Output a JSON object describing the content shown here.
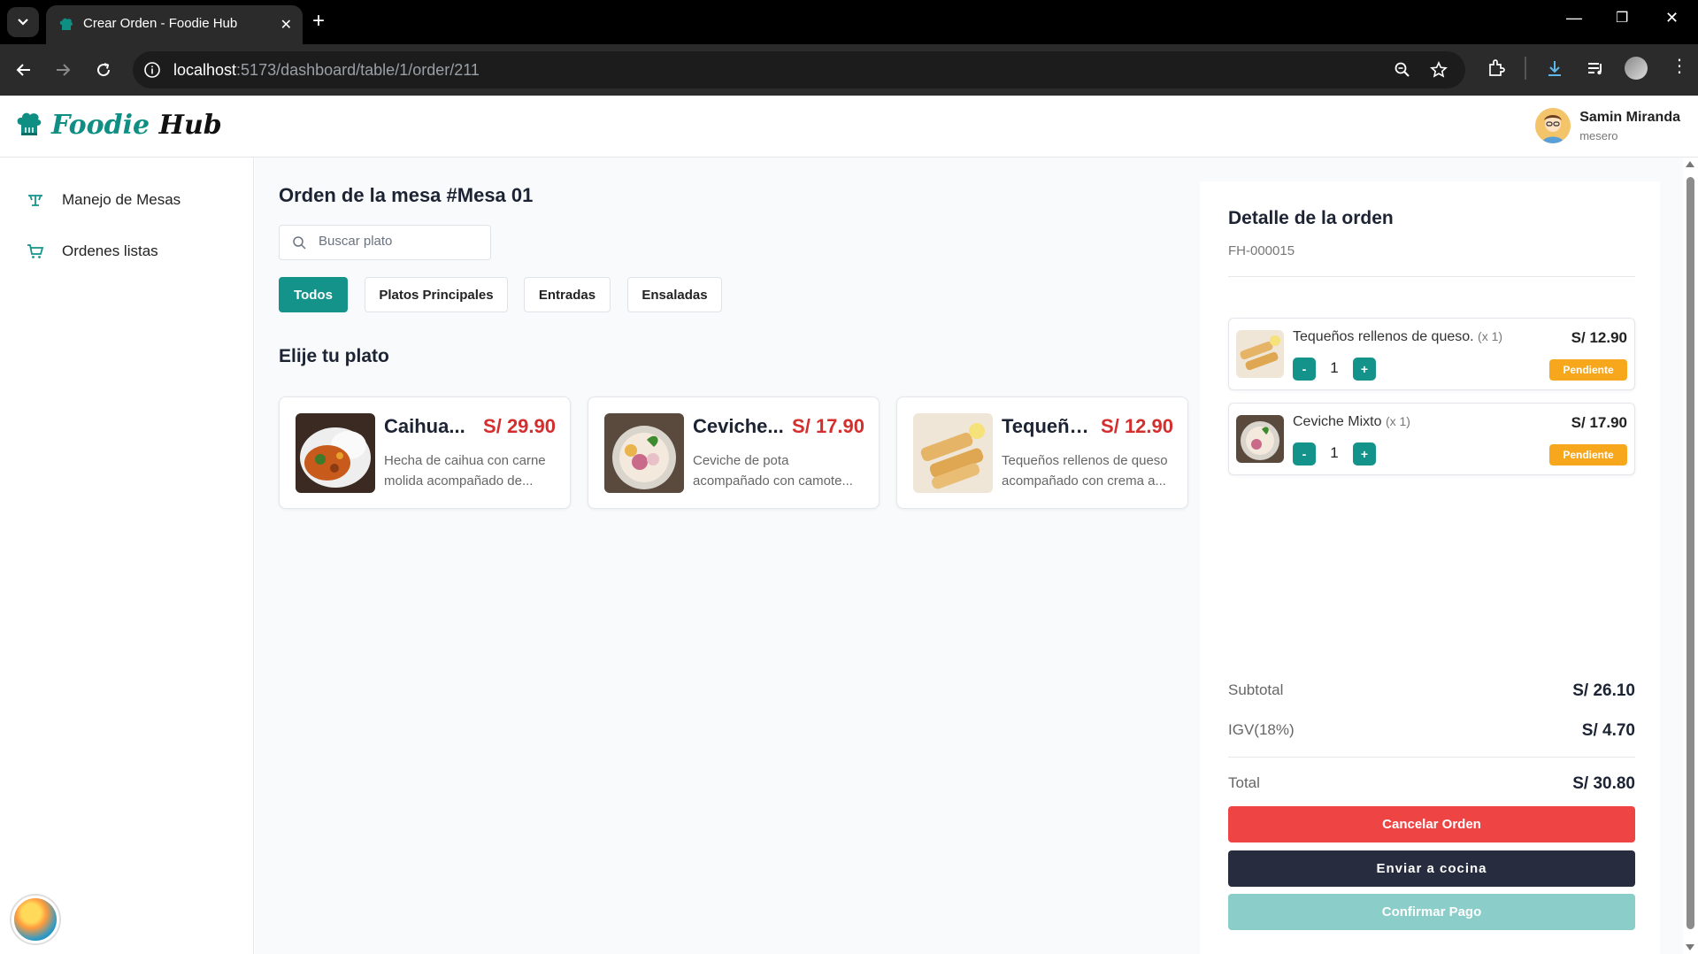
{
  "browser": {
    "tab_title": "Crear Orden - Foodie Hub",
    "url_host": "localhost",
    "url_path": ":5173/dashboard/table/1/order/211"
  },
  "header": {
    "logo_foodie": "Foodie",
    "logo_hub": "Hub",
    "user_name": "Samin Miranda",
    "user_role": "mesero"
  },
  "sidebar": {
    "items": [
      {
        "label": "Manejo de Mesas",
        "icon": "table-icon"
      },
      {
        "label": "Ordenes listas",
        "icon": "cart-icon"
      }
    ]
  },
  "main": {
    "title": "Orden de la mesa #Mesa 01",
    "search_placeholder": "Buscar plato",
    "categories": [
      "Todos",
      "Platos Principales",
      "Entradas",
      "Ensaladas"
    ],
    "active_category": "Todos",
    "section_title": "Elije tu plato",
    "dishes": [
      {
        "name": "Caihua...",
        "price": "S/ 29.90",
        "description": "Hecha de caihua con carne molida acompañado de..."
      },
      {
        "name": "Ceviche...",
        "price": "S/ 17.90",
        "description": "Ceviche de pota acompañado con camote..."
      },
      {
        "name": "Tequeños...",
        "price": "S/ 12.90",
        "description": "Tequeños rellenos de queso acompañado con crema a..."
      }
    ]
  },
  "order": {
    "title": "Detalle de la orden",
    "code": "FH-000015",
    "items": [
      {
        "name": "Tequeños rellenos de queso.",
        "qty_label": "(x 1)",
        "price": "S/ 12.90",
        "quantity": "1",
        "status": "Pendiente",
        "minus": "-",
        "plus": "+"
      },
      {
        "name": "Ceviche Mixto",
        "qty_label": "(x 1)",
        "price": "S/ 17.90",
        "quantity": "1",
        "status": "Pendiente",
        "minus": "-",
        "plus": "+"
      }
    ],
    "subtotal_label": "Subtotal",
    "subtotal": "S/ 26.10",
    "igv_label": "IGV(18%)",
    "igv": "S/ 4.70",
    "total_label": "Total",
    "total": "S/ 30.80",
    "cancel_label": "Cancelar Orden",
    "kitchen_label": "Enviar a cocina",
    "pay_label": "Confirmar Pago"
  },
  "colors": {
    "brand_teal": "#14938b",
    "price_red": "#d32f2f",
    "status_orange": "#f7a71c",
    "cancel_red": "#ef4444",
    "kitchen_navy": "#272d3f",
    "pay_disabled": "#8acdc9"
  }
}
